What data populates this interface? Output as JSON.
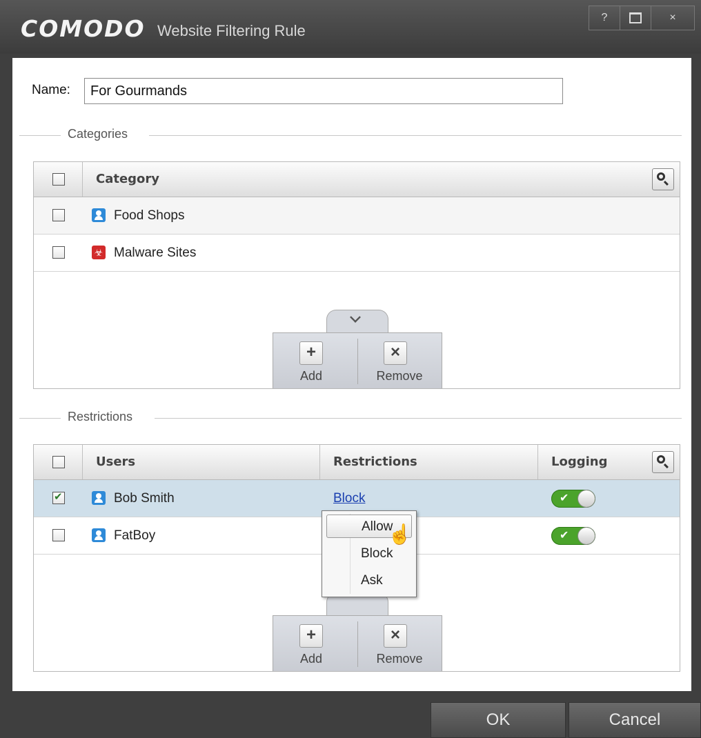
{
  "window": {
    "brand": "COMODO",
    "title": "Website Filtering Rule",
    "controls": {
      "help": "?",
      "close": "×"
    }
  },
  "name_field": {
    "label": "Name:",
    "value": "For Gourmands"
  },
  "categories": {
    "section_label": "Categories",
    "column_header": "Category",
    "rows": [
      {
        "label": "Food Shops",
        "icon": "user-icon",
        "checked": false
      },
      {
        "label": "Malware Sites",
        "icon": "biohazard-icon",
        "checked": false
      }
    ],
    "actions": {
      "add_label": "Add",
      "remove_label": "Remove"
    }
  },
  "restrictions": {
    "section_label": "Restrictions",
    "headers": {
      "users": "Users",
      "restrictions": "Restrictions",
      "logging": "Logging"
    },
    "rows": [
      {
        "user": "Bob Smith",
        "restriction": "Block",
        "logging": true,
        "checked": true,
        "selected": true
      },
      {
        "user": "FatBoy",
        "restriction": "",
        "logging": true,
        "checked": false,
        "selected": false
      }
    ],
    "actions": {
      "add_label": "Add",
      "remove_label": "Remove"
    },
    "context_menu": {
      "items": [
        "Allow",
        "Block",
        "Ask"
      ],
      "hovered": "Allow"
    }
  },
  "footer": {
    "ok_label": "OK",
    "cancel_label": "Cancel"
  },
  "colors": {
    "selected_row": "#cfdfea",
    "link": "#1a3fb0",
    "toggle_on": "#4ba32b",
    "chrome": "#3f3f3f"
  }
}
